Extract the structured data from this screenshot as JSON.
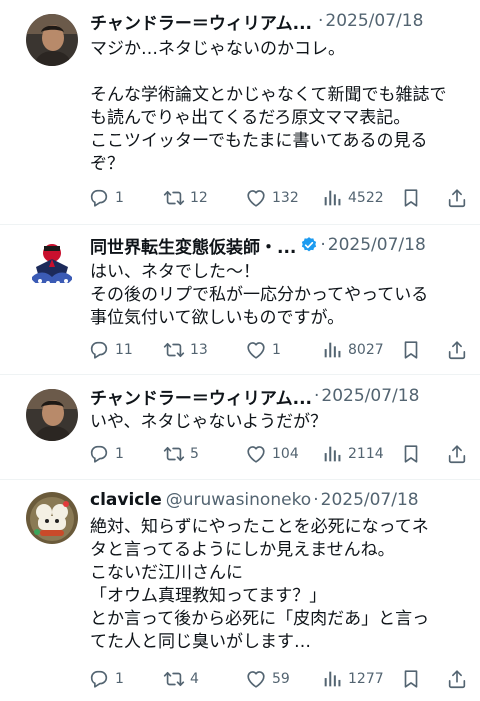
{
  "tweets": [
    {
      "name": "チャンドラー＝ウィリアム...",
      "handle": "",
      "date": "2025/07/18",
      "verified": false,
      "lines": [
        "マジか…ネタじゃないのかコレ。",
        "",
        "そんな学術論文とかじゃなくて新聞でも雑誌で",
        "も読んでりゃ出てくるだろ原文ママ表記。",
        "ここツイッターでもたまに書いてあるの見る",
        "ぞ？"
      ],
      "replies": "1",
      "retweets": "12",
      "likes": "132",
      "views": "4522"
    },
    {
      "name": "同世界転生変態仮装師・...",
      "handle": "",
      "date": "2025/07/18",
      "verified": true,
      "lines": [
        "はい、ネタでした～！",
        "その後のリプで私が一応分かってやっている",
        "事位気付いて欲しいものですが。"
      ],
      "replies": "11",
      "retweets": "13",
      "likes": "1",
      "views": "8027"
    },
    {
      "name": "チャンドラー＝ウィリアム...",
      "handle": "",
      "date": "2025/07/18",
      "verified": false,
      "lines": [
        "いや、ネタじゃないようだが？"
      ],
      "replies": "1",
      "retweets": "5",
      "likes": "104",
      "views": "2114"
    },
    {
      "name": "clavicle",
      "handle": "@uruwasinoneko",
      "date": "2025/07/18",
      "verified": false,
      "lines": [
        "絶対、知らずにやったことを必死になってネ",
        "タと言ってるようにしか見えませんね。",
        "こないだ江川さんに",
        "「オウム真理教知ってます？」",
        "とか言って後から必死に「皮肉だあ」と言っ",
        "てた人と同じ臭いがします…"
      ],
      "replies": "1",
      "retweets": "4",
      "likes": "59",
      "views": "1277"
    }
  ],
  "colors": {
    "text": "#0f1419",
    "muted": "#536471",
    "verified": "#1d9bf0",
    "divider": "#eff3f4"
  },
  "icons": [
    "reply-icon",
    "retweet-icon",
    "like-icon",
    "views-icon",
    "bookmark-icon",
    "share-icon",
    "verified-badge-icon"
  ]
}
